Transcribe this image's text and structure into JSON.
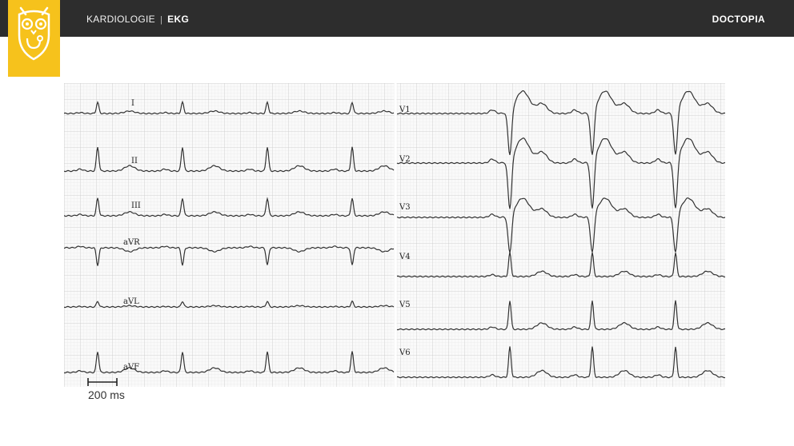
{
  "header": {
    "section": "KARDIOLOGIE",
    "separator": "|",
    "page": "EKG",
    "brand": "DOCTOPIA"
  },
  "colors": {
    "header_bg": "#2d2d2d",
    "logo_bg": "#f6c21c",
    "grid": "#c9c9c9",
    "trace": "#333333"
  },
  "ecg": {
    "limb_leads": [
      "I",
      "II",
      "III",
      "aVR",
      "aVL",
      "aVF"
    ],
    "chest_leads": [
      "V1",
      "V2",
      "V3",
      "V4",
      "V5",
      "V6"
    ],
    "scale_label": "200 ms"
  }
}
